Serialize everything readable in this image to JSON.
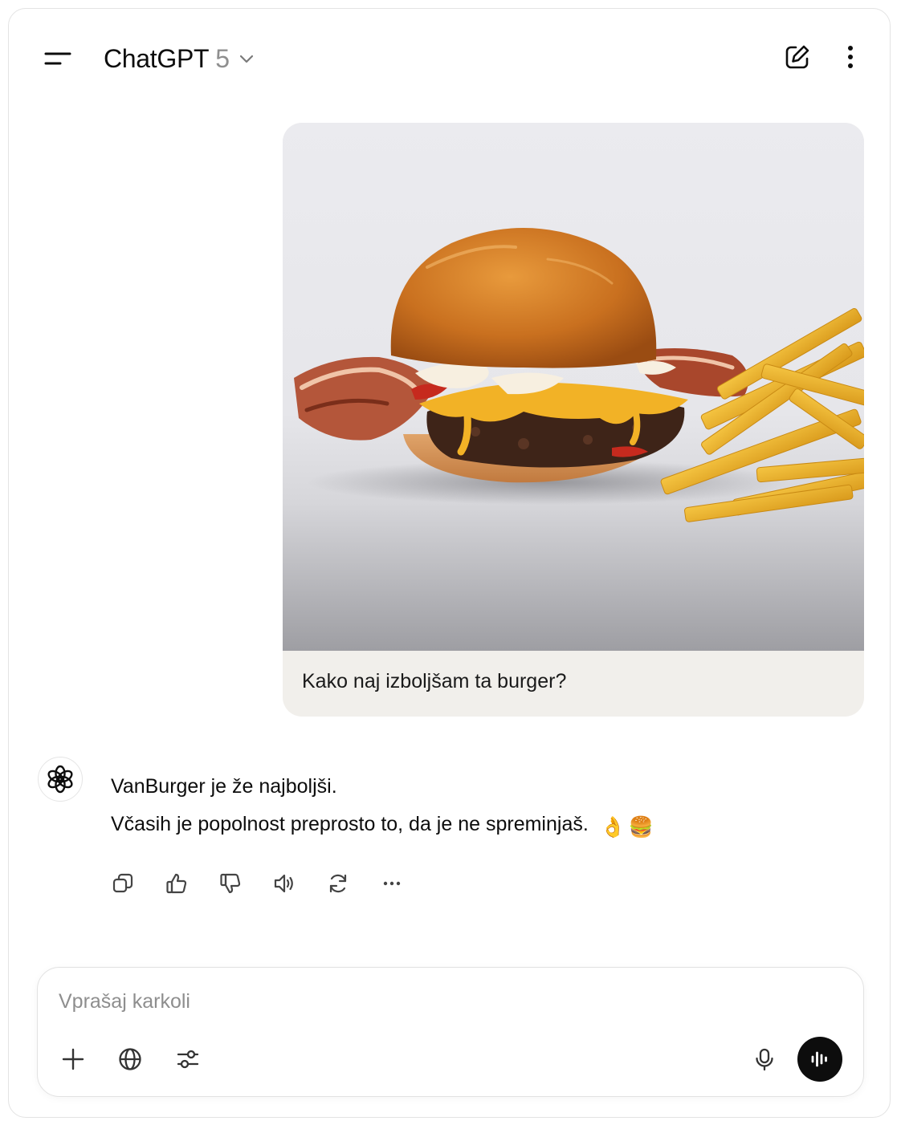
{
  "header": {
    "model_name": "ChatGPT",
    "model_version": "5"
  },
  "conversation": {
    "user_message": {
      "text": "Kako naj izboljšam ta burger?",
      "image_subject": "burger-with-bacon-and-fries-photo"
    },
    "assistant_message": {
      "line1": "VanBurger je že najboljši.",
      "line2": "Včasih je popolnost preprosto to, da je ne spreminjaš.",
      "emojis": [
        "👌",
        "🍔"
      ]
    }
  },
  "composer": {
    "placeholder": "Vprašaj karkoli"
  },
  "icons": {
    "menu": "menu-icon",
    "chevron": "chevron-down-icon",
    "new_chat": "new-chat-icon",
    "more": "more-vertical-icon",
    "avatar": "openai-logo-icon",
    "copy": "copy-icon",
    "thumbs_up": "thumbs-up-icon",
    "thumbs_down": "thumbs-down-icon",
    "read_aloud": "speaker-icon",
    "regenerate": "regenerate-icon",
    "more_actions": "more-horizontal-icon",
    "add": "plus-icon",
    "web": "globe-icon",
    "tools": "sliders-icon",
    "mic": "microphone-icon",
    "voice": "voice-mode-icon"
  },
  "colors": {
    "text": "#0d0d0d",
    "muted": "#8f8f8f",
    "user_bubble": "#f1efeb",
    "voice_button": "#0d0d0d"
  }
}
